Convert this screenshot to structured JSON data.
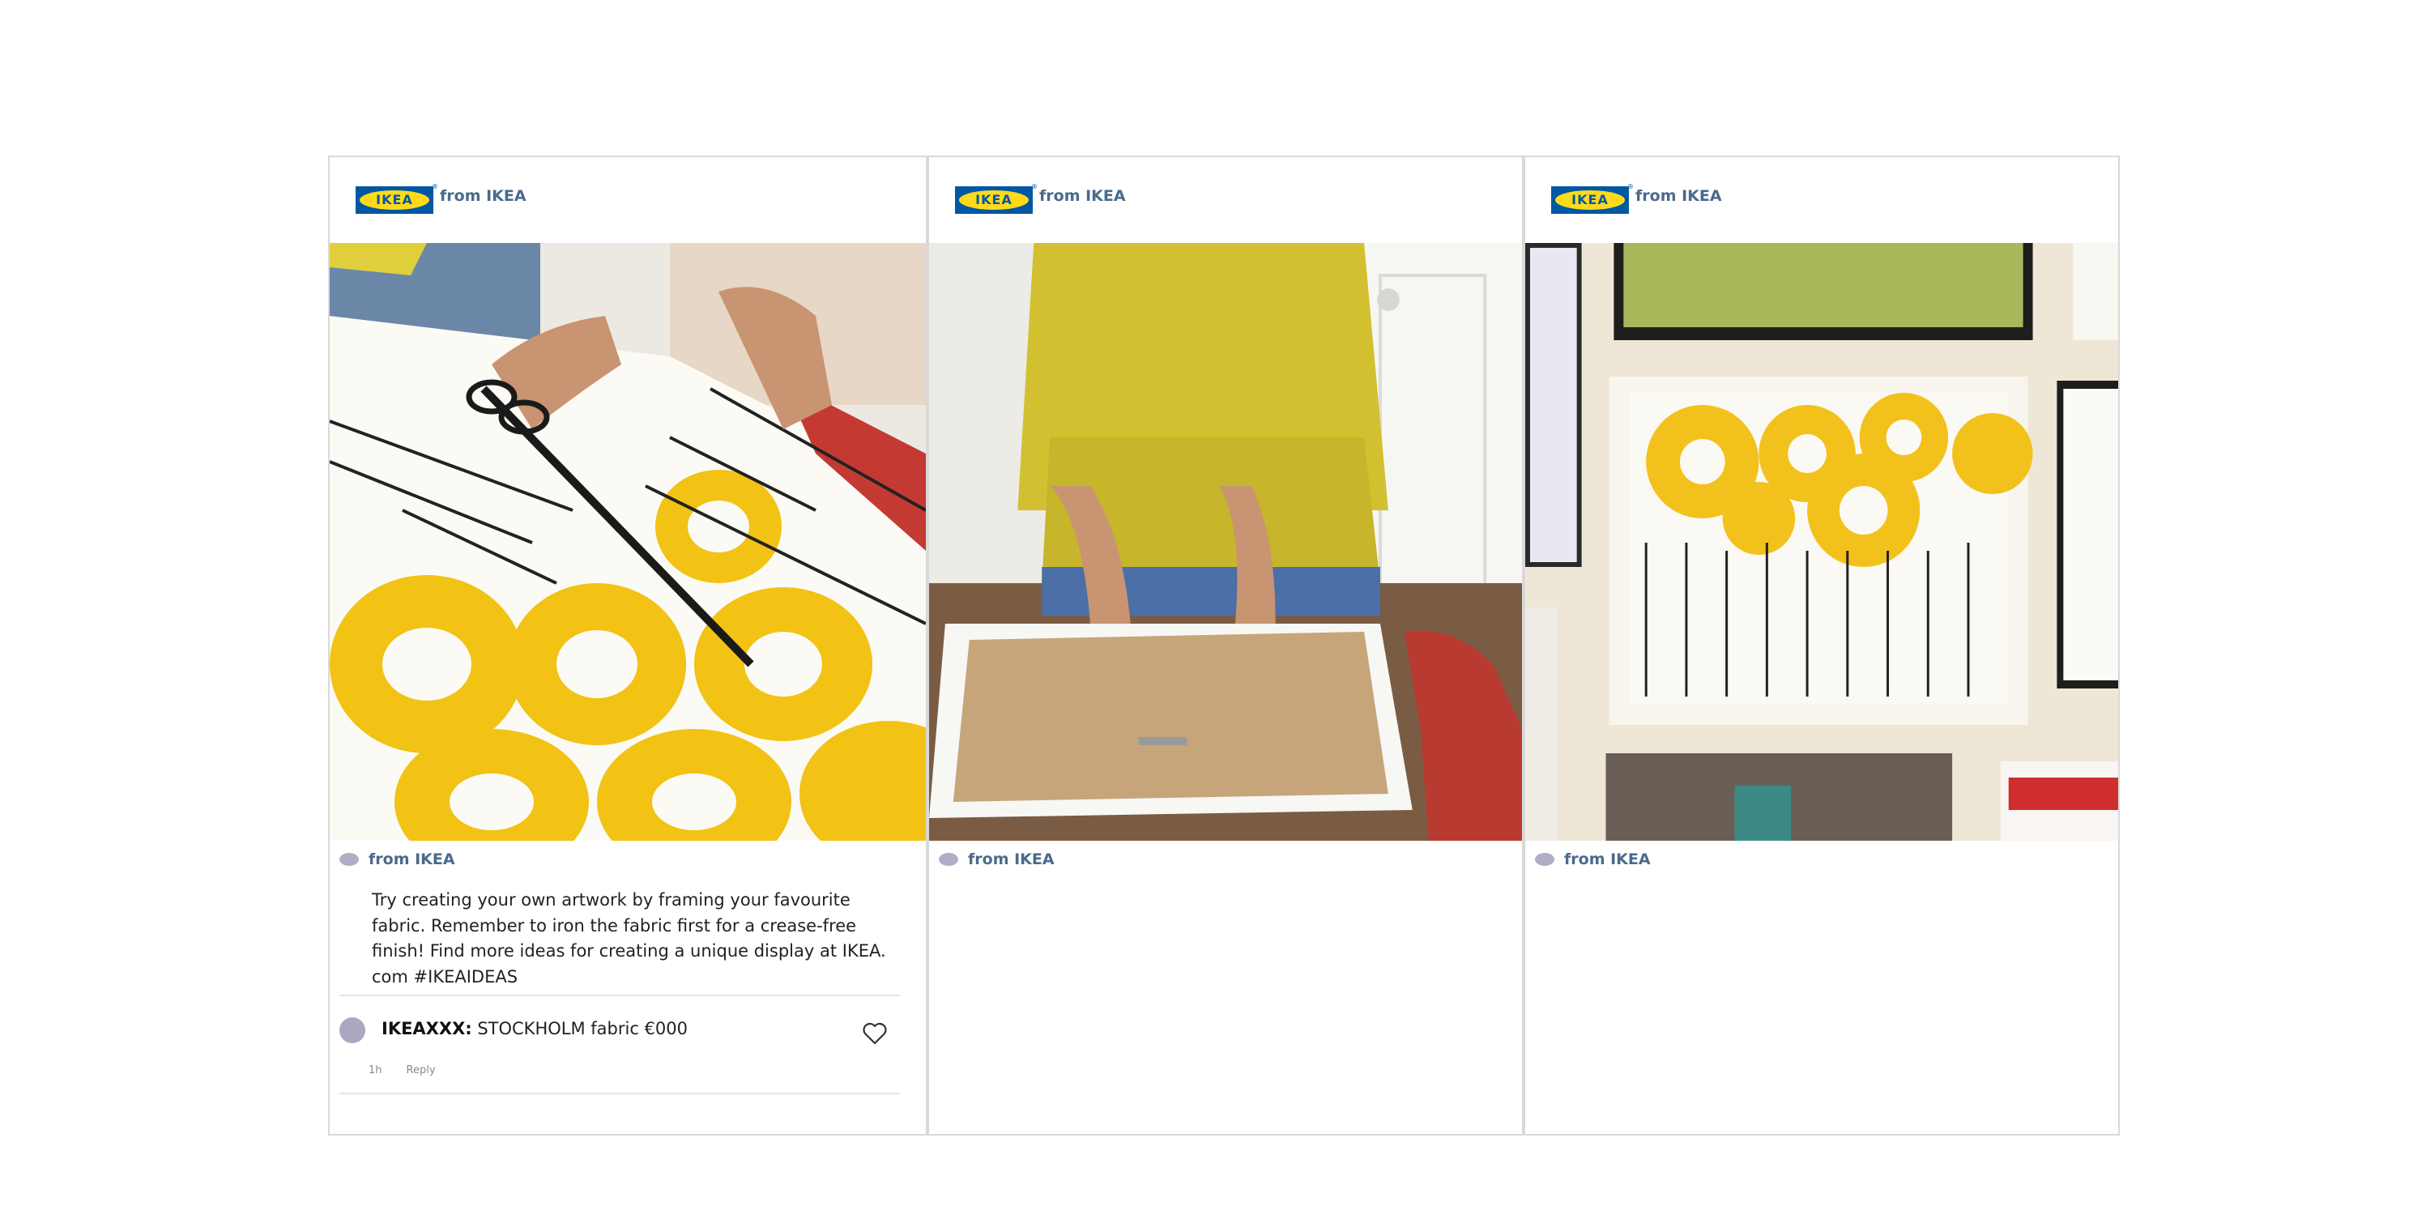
{
  "cards": [
    {
      "logo_text": "IKEA",
      "header_source": "from IKEA",
      "meta_source": "from IKEA",
      "caption": "Try creating your own artwork by framing your favourite fabric. Remember to iron the fabric first for a crease-free finish! Find more ideas for creating a unique display at IKEA. com #IKEAIDEAS",
      "comment": {
        "user": "IKEAXXX:",
        "text": " STOCKHOLM fabric €000",
        "time": "1h",
        "reply": "Reply"
      }
    },
    {
      "logo_text": "IKEA",
      "header_source": "from IKEA",
      "meta_source": "from IKEA"
    },
    {
      "logo_text": "IKEA",
      "header_source": "from IKEA",
      "meta_source": "from IKEA"
    }
  ],
  "colors": {
    "brand_blue": "#0058a3",
    "brand_yellow": "#ffda1a",
    "source_text": "#4a6a8c"
  }
}
